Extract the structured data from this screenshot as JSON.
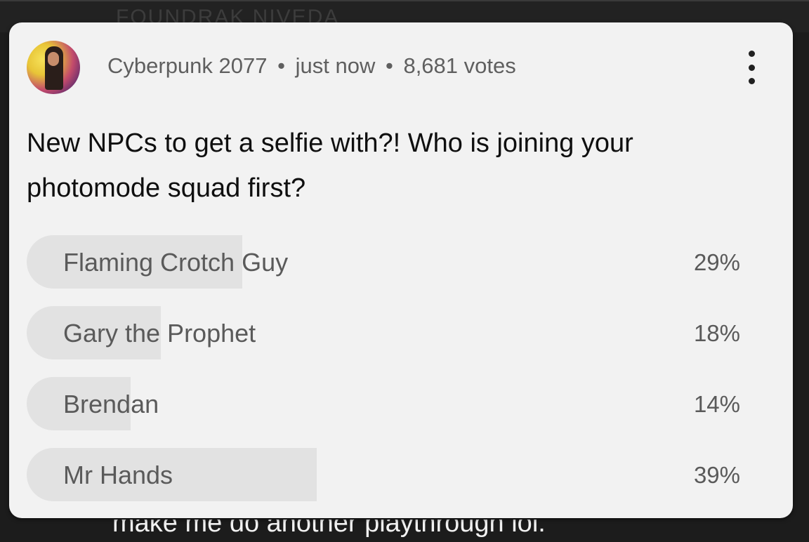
{
  "background": {
    "top_text": "FOUNDRAK NIVEDA",
    "bottom_text": "make me do another playthrough lol."
  },
  "post": {
    "channel": "Cyberpunk 2077",
    "separator": "•",
    "time": "just now",
    "votes": "8,681 votes",
    "menu_icon": "more-vert-icon",
    "question": "New NPCs to get a selfie with?! Who is joining your photomode squad first?"
  },
  "poll": {
    "options": [
      {
        "label": "Flaming Crotch Guy",
        "percent_label": "29%",
        "percent": 29
      },
      {
        "label": "Gary the Prophet",
        "percent_label": "18%",
        "percent": 18
      },
      {
        "label": "Brendan",
        "percent_label": "14%",
        "percent": 14
      },
      {
        "label": "Mr Hands",
        "percent_label": "39%",
        "percent": 39
      }
    ]
  },
  "colors": {
    "card_bg": "#f2f2f2",
    "bar_fill": "#e2e2e2",
    "page_bg": "#1c1c1c"
  }
}
